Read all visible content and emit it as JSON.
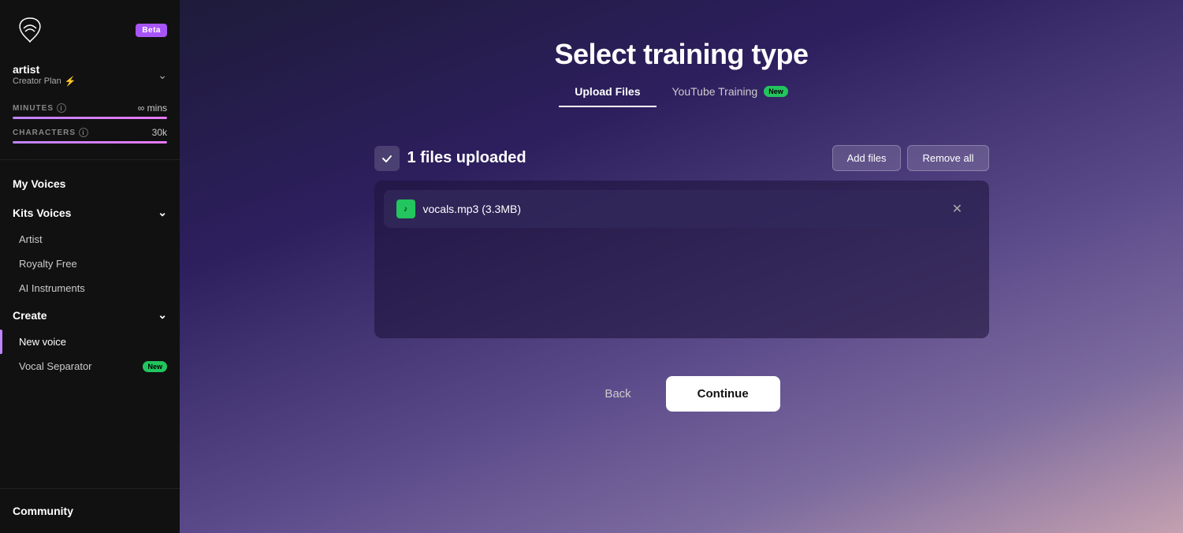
{
  "sidebar": {
    "beta_label": "Beta",
    "logo_alt": "Kits AI Logo",
    "account": {
      "name": "artist",
      "plan": "Creator Plan",
      "plan_icon": "⚡"
    },
    "minutes": {
      "label": "MINUTES",
      "value": "∞ mins",
      "bar_pct": 100
    },
    "characters": {
      "label": "CHARACTERS",
      "value": "30k",
      "bar_pct": 100
    },
    "my_voices_label": "My Voices",
    "kits_voices_label": "Kits Voices",
    "kits_voices_sub": [
      "Artist",
      "Royalty Free",
      "AI Instruments"
    ],
    "create_label": "Create",
    "create_sub": [
      {
        "label": "New voice",
        "active": true,
        "new_badge": false
      },
      {
        "label": "Vocal Separator",
        "active": false,
        "new_badge": true
      }
    ],
    "community_label": "Community"
  },
  "main": {
    "page_title": "Select training type",
    "tabs": [
      {
        "label": "Upload Files",
        "active": true,
        "new_badge": false
      },
      {
        "label": "YouTube Training",
        "active": false,
        "new_badge": true
      }
    ],
    "files_count_label": "1 files uploaded",
    "add_files_label": "Add files",
    "remove_all_label": "Remove all",
    "files": [
      {
        "name": "vocals.mp3 (3.3MB)",
        "type": "MP3"
      }
    ],
    "back_label": "Back",
    "continue_label": "Continue"
  }
}
